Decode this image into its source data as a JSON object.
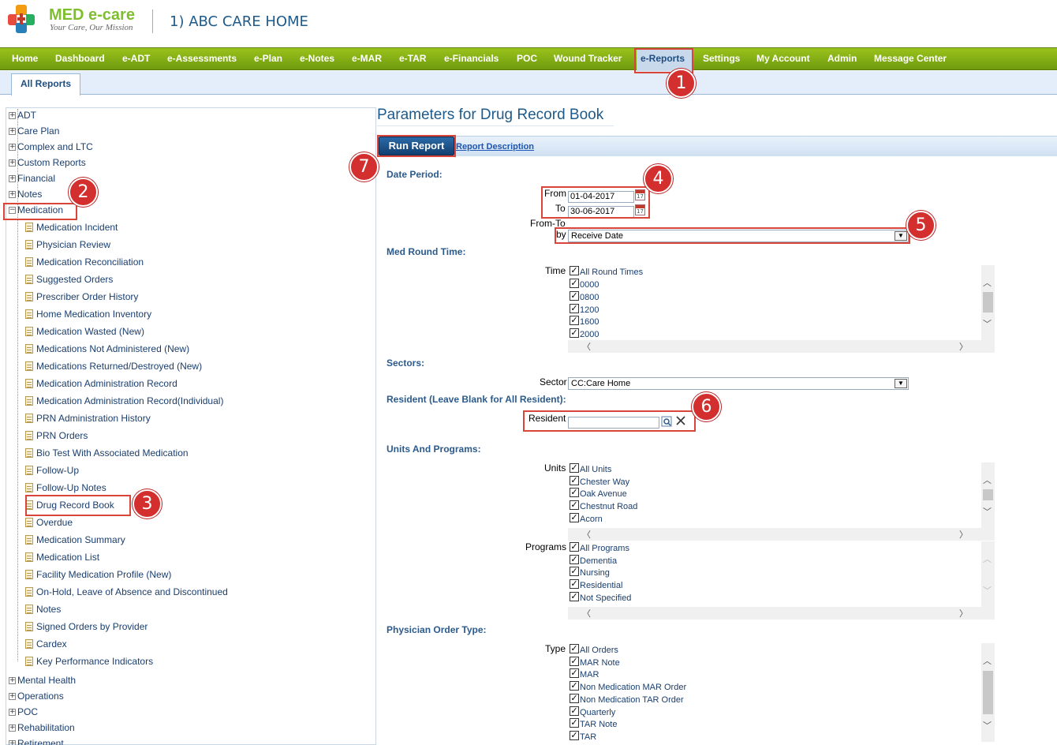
{
  "header": {
    "brand": "MED e-care",
    "tagline": "Your Care, Our Mission",
    "facility": "1) ABC CARE HOME"
  },
  "nav": {
    "items": [
      "Home",
      "Dashboard",
      "e-ADT",
      "e-Assessments",
      "e-Plan",
      "e-Notes",
      "e-MAR",
      "e-TAR",
      "e-Financials",
      "POC",
      "Wound Tracker",
      "e-Reports",
      "Settings",
      "My Account",
      "Admin",
      "Message Center"
    ],
    "active": "e-Reports"
  },
  "subtab": "All Reports",
  "tree": {
    "top_before": [
      "ADT",
      "Care Plan",
      "Complex and LTC",
      "Custom Reports",
      "Financial",
      "Notes"
    ],
    "expanded": "Medication",
    "medication_children": [
      "Medication Incident",
      "Physician Review",
      "Medication Reconciliation",
      "Suggested Orders",
      "Prescriber Order History",
      "Home Medication Inventory",
      "Medication Wasted (New)",
      "Medications Not Administered (New)",
      "Medications Returned/Destroyed (New)",
      "Medication Administration Record",
      "Medication Administration Record(Individual)",
      "PRN Administration History",
      "PRN Orders",
      "Bio Test With Associated Medication",
      "Follow-Up",
      "Follow-Up Notes",
      "Drug Record Book",
      "Overdue",
      "Medication Summary",
      "Medication List",
      "Facility Medication Profile (New)",
      "On-Hold, Leave of Absence and Discontinued",
      "Notes",
      "Signed Orders by Provider",
      "Cardex",
      "Key Performance Indicators"
    ],
    "top_after": [
      "Mental Health",
      "Operations",
      "POC",
      "Rehabilitation",
      "Retirement"
    ]
  },
  "params": {
    "title": "Parameters for Drug Record Book",
    "run_label": "Run Report",
    "desc_link": "Report Description",
    "date_period": {
      "section": "Date Period:",
      "from_label": "From",
      "from_value": "01-04-2017",
      "to_label": "To",
      "to_value": "30-06-2017",
      "fromto_label": "From-To",
      "by_label": "by",
      "by_value": "Receive Date"
    },
    "med_round": {
      "section": "Med Round Time:",
      "label": "Time",
      "options": [
        "All Round Times",
        "0000",
        "0800",
        "1200",
        "1600",
        "2000"
      ]
    },
    "sectors": {
      "section": "Sectors:",
      "label": "Sector",
      "value": "CC:Care Home"
    },
    "resident": {
      "section": "Resident (Leave Blank for All Resident):",
      "label": "Resident",
      "value": ""
    },
    "units_programs": {
      "section": "Units And Programs:",
      "units_label": "Units",
      "units": [
        "All Units",
        "Chester Way",
        "Oak Avenue",
        "Chestnut Road",
        "Acorn"
      ],
      "programs_label": "Programs",
      "programs": [
        "All Programs",
        "Dementia",
        "Nursing",
        "Residential",
        "Not Specified"
      ]
    },
    "order_type": {
      "section": "Physician Order Type:",
      "label": "Type",
      "options": [
        "All Orders",
        "MAR Note",
        "MAR",
        "Non Medication MAR Order",
        "Non Medication TAR Order",
        "Quarterly",
        "TAR Note",
        "TAR"
      ]
    }
  },
  "callouts": [
    "1",
    "2",
    "3",
    "4",
    "5",
    "6",
    "7"
  ]
}
